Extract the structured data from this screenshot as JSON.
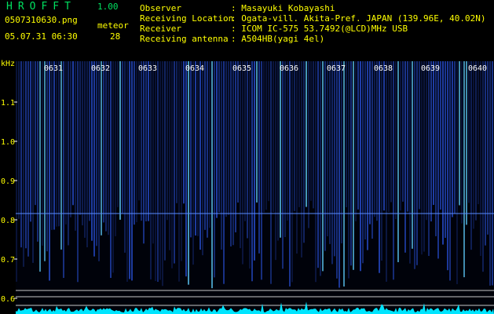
{
  "header": {
    "app_name": "HROFFT",
    "version": "1.00",
    "file_name": "0507310630.png",
    "timestamp": "05.07.31 06:30",
    "meteor_label": "meteor",
    "meteor_count": "28"
  },
  "station": {
    "rows": [
      {
        "label": "Observer",
        "value": ": Masayuki Kobayashi"
      },
      {
        "label": "Receiving Location",
        "value": ": Ogata-vill. Akita-Pref. JAPAN (139.96E, 40.02N)"
      },
      {
        "label": "Receiver",
        "value": ": ICOM IC-575 53.7492(@LCD)MHz USB"
      },
      {
        "label": "Receiving antenna",
        "value": ": A504HB(yagi 4el)"
      }
    ]
  },
  "spectrogram": {
    "y_unit": "kHz",
    "y_ticks": [
      "1.1",
      "1.0",
      "0.9",
      "0.8",
      "0.7",
      "0.6"
    ],
    "time_ticks": [
      "0631",
      "0632",
      "0633",
      "0634",
      "0635",
      "0636",
      "0637",
      "0638",
      "0639",
      "0640"
    ],
    "colors": {
      "background": "#000000",
      "signal": "#3060ff",
      "accent": "#60d0ff",
      "text": "#ffff00",
      "title": "#00e060"
    }
  }
}
